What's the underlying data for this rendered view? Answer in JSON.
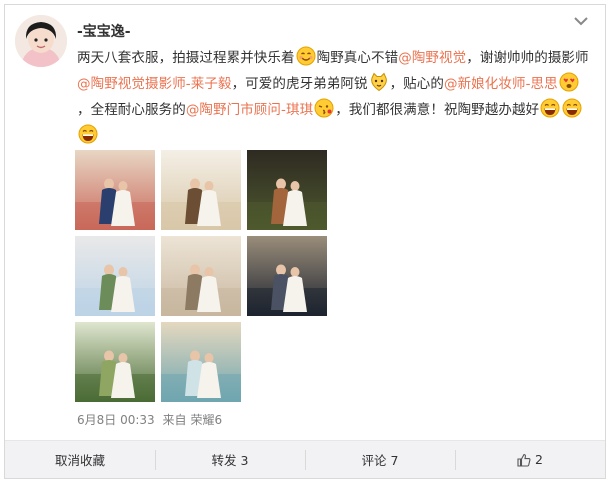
{
  "post": {
    "username": "-宝宝逸-",
    "text_segments": [
      {
        "type": "text",
        "value": "两天八套衣服，拍摄过程累并快乐着"
      },
      {
        "type": "emoji",
        "name": "smile-emoji"
      },
      {
        "type": "text",
        "value": "陶野真心不错"
      },
      {
        "type": "mention",
        "value": "@陶野视觉"
      },
      {
        "type": "text",
        "value": "，谢谢帅帅的摄影师"
      },
      {
        "type": "mention",
        "value": "@陶野视觉摄影师-莱子毅"
      },
      {
        "type": "text",
        "value": "，可爱的虎牙弟弟阿锐"
      },
      {
        "type": "emoji",
        "name": "cat-emoji"
      },
      {
        "type": "text",
        "value": "，贴心的"
      },
      {
        "type": "mention",
        "value": "@新娘化妆师-思思"
      },
      {
        "type": "emoji",
        "name": "love-emoji"
      },
      {
        "type": "text",
        "value": "，全程耐心服务的"
      },
      {
        "type": "mention",
        "value": "@陶野门市顾问-琪琪"
      },
      {
        "type": "emoji",
        "name": "kiss-emoji"
      },
      {
        "type": "text",
        "value": "，我们都很满意！祝陶野越办越好"
      },
      {
        "type": "emoji",
        "name": "laugh-emoji"
      },
      {
        "type": "emoji",
        "name": "laugh-emoji"
      },
      {
        "type": "emoji",
        "name": "laugh-emoji"
      }
    ],
    "photos": [
      {
        "name": "photo-couple-red-wall",
        "palette": [
          "#c9685a",
          "#2a3f6e",
          "#e8d6c4"
        ]
      },
      {
        "name": "photo-couple-indoor-sofa",
        "palette": [
          "#d8c7a8",
          "#6b4e34",
          "#f4efe6"
        ]
      },
      {
        "name": "photo-couple-garden-steps",
        "palette": [
          "#4e5a2e",
          "#a2653c",
          "#2e2a22"
        ]
      },
      {
        "name": "photo-couple-palace-garden",
        "palette": [
          "#bcd3e6",
          "#6c8d5a",
          "#e9e9e9"
        ]
      },
      {
        "name": "photo-couple-columns",
        "palette": [
          "#c8b79f",
          "#8d7a63",
          "#ede4d6"
        ]
      },
      {
        "name": "photo-couple-night-street",
        "palette": [
          "#1e2430",
          "#4a5264",
          "#9a8d7a"
        ]
      },
      {
        "name": "photo-couple-forest-lawn",
        "palette": [
          "#4b6b35",
          "#8fa662",
          "#dfe6cf"
        ]
      },
      {
        "name": "photo-couple-beach",
        "palette": [
          "#6fa6b0",
          "#cfe3e6",
          "#e4d8bf"
        ]
      }
    ],
    "date": "6月8日 00:33",
    "source_prefix": "来自",
    "source": "荣耀6"
  },
  "actions": {
    "favorite": "取消收藏",
    "repost": "转发 3",
    "comment": "评论 7",
    "like": "2"
  },
  "colors": {
    "mention": "#eb7350",
    "text": "#333333",
    "meta": "#808080",
    "action_bar_bg": "#f2f2f5"
  }
}
